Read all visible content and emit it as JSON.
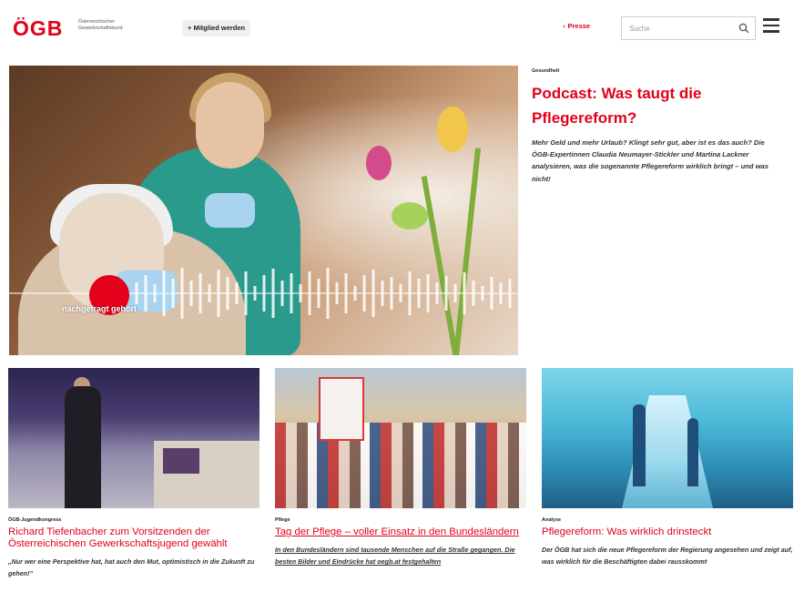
{
  "header": {
    "logo": "ÖGB",
    "logo_subtitle": "Österreichischer Gewerkschaftsbund",
    "join_label": "+ Mitglied werden",
    "press_label": "Presse",
    "search_placeholder": "Suche"
  },
  "hero": {
    "podcast_badge": "nachgefragt gehört",
    "category": "Gesundheit",
    "title": "Podcast: Was taugt die Pflegereform?",
    "teaser": "Mehr Geld und mehr Urlaub? Klingt sehr gut, aber ist es das auch? Die ÖGB-Expertinnen Claudia Neumayer-Stickler und Martina Lackner analysieren, was die sogenannte Pflegereform wirklich bringt – und was nicht!"
  },
  "cards": [
    {
      "category": "ÖGB-Jugendkongress",
      "title": "Richard Tiefenbacher zum Vorsitzenden der Österreichischen Gewerkschaftsjugend gewählt",
      "teaser": "„Nur wer eine Perspektive hat, hat auch den Mut, optimistisch in die Zukunft zu gehen!\""
    },
    {
      "category": "Pflege",
      "title": "Tag der Pflege – voller Einsatz in den Bundesländern",
      "teaser": "In den Bundesländern sind tausende Menschen auf die Straße gegangen. Die besten Bilder und Eindrücke hat oegb.at festgehalten"
    },
    {
      "category": "Analyse",
      "title": "Pflegereform: Was wirklich drinsteckt",
      "teaser": "Der ÖGB hat sich die neue Pflegereform der Regierung angesehen und zeigt auf, was wirklich für die Beschäftigten dabei rausskommt"
    }
  ],
  "colors": {
    "brand_red": "#e2001a"
  }
}
